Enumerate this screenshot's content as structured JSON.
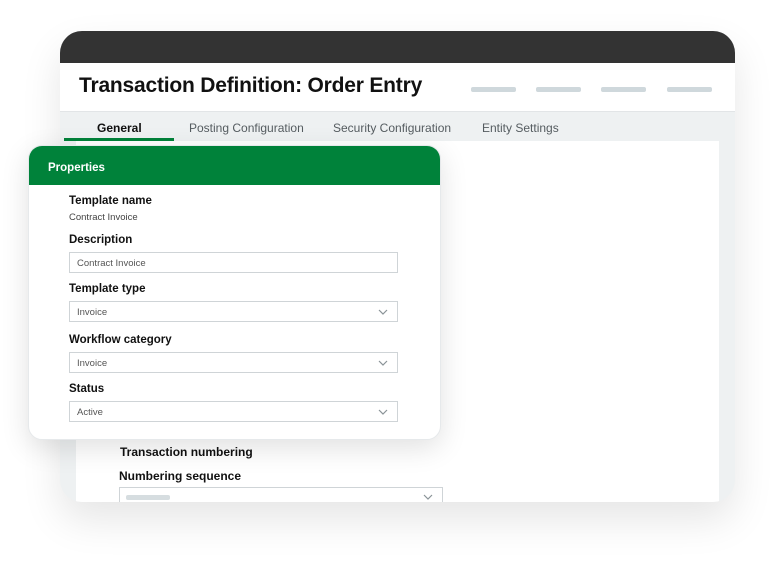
{
  "window": {
    "title": "Transaction Definition: Order Entry"
  },
  "tabs": [
    {
      "label": "General"
    },
    {
      "label": "Posting Configuration"
    },
    {
      "label": "Security Configuration"
    },
    {
      "label": "Entity Settings"
    }
  ],
  "panel": {
    "title": "Properties",
    "template_name_label": "Template name",
    "template_name_value": "Contract Invoice",
    "description_label": "Description",
    "description_value": "Contract Invoice",
    "template_type_label": "Template type",
    "template_type_value": "Invoice",
    "workflow_category_label": "Workflow category",
    "workflow_category_value": "Invoice",
    "status_label": "Status",
    "status_value": "Active"
  },
  "background_form": {
    "section_title": "Transaction numbering",
    "numbering_label": "Numbering sequence"
  },
  "colors": {
    "accent": "#00823a",
    "titlebar": "#333333",
    "placeholder": "#cfd8dc"
  }
}
